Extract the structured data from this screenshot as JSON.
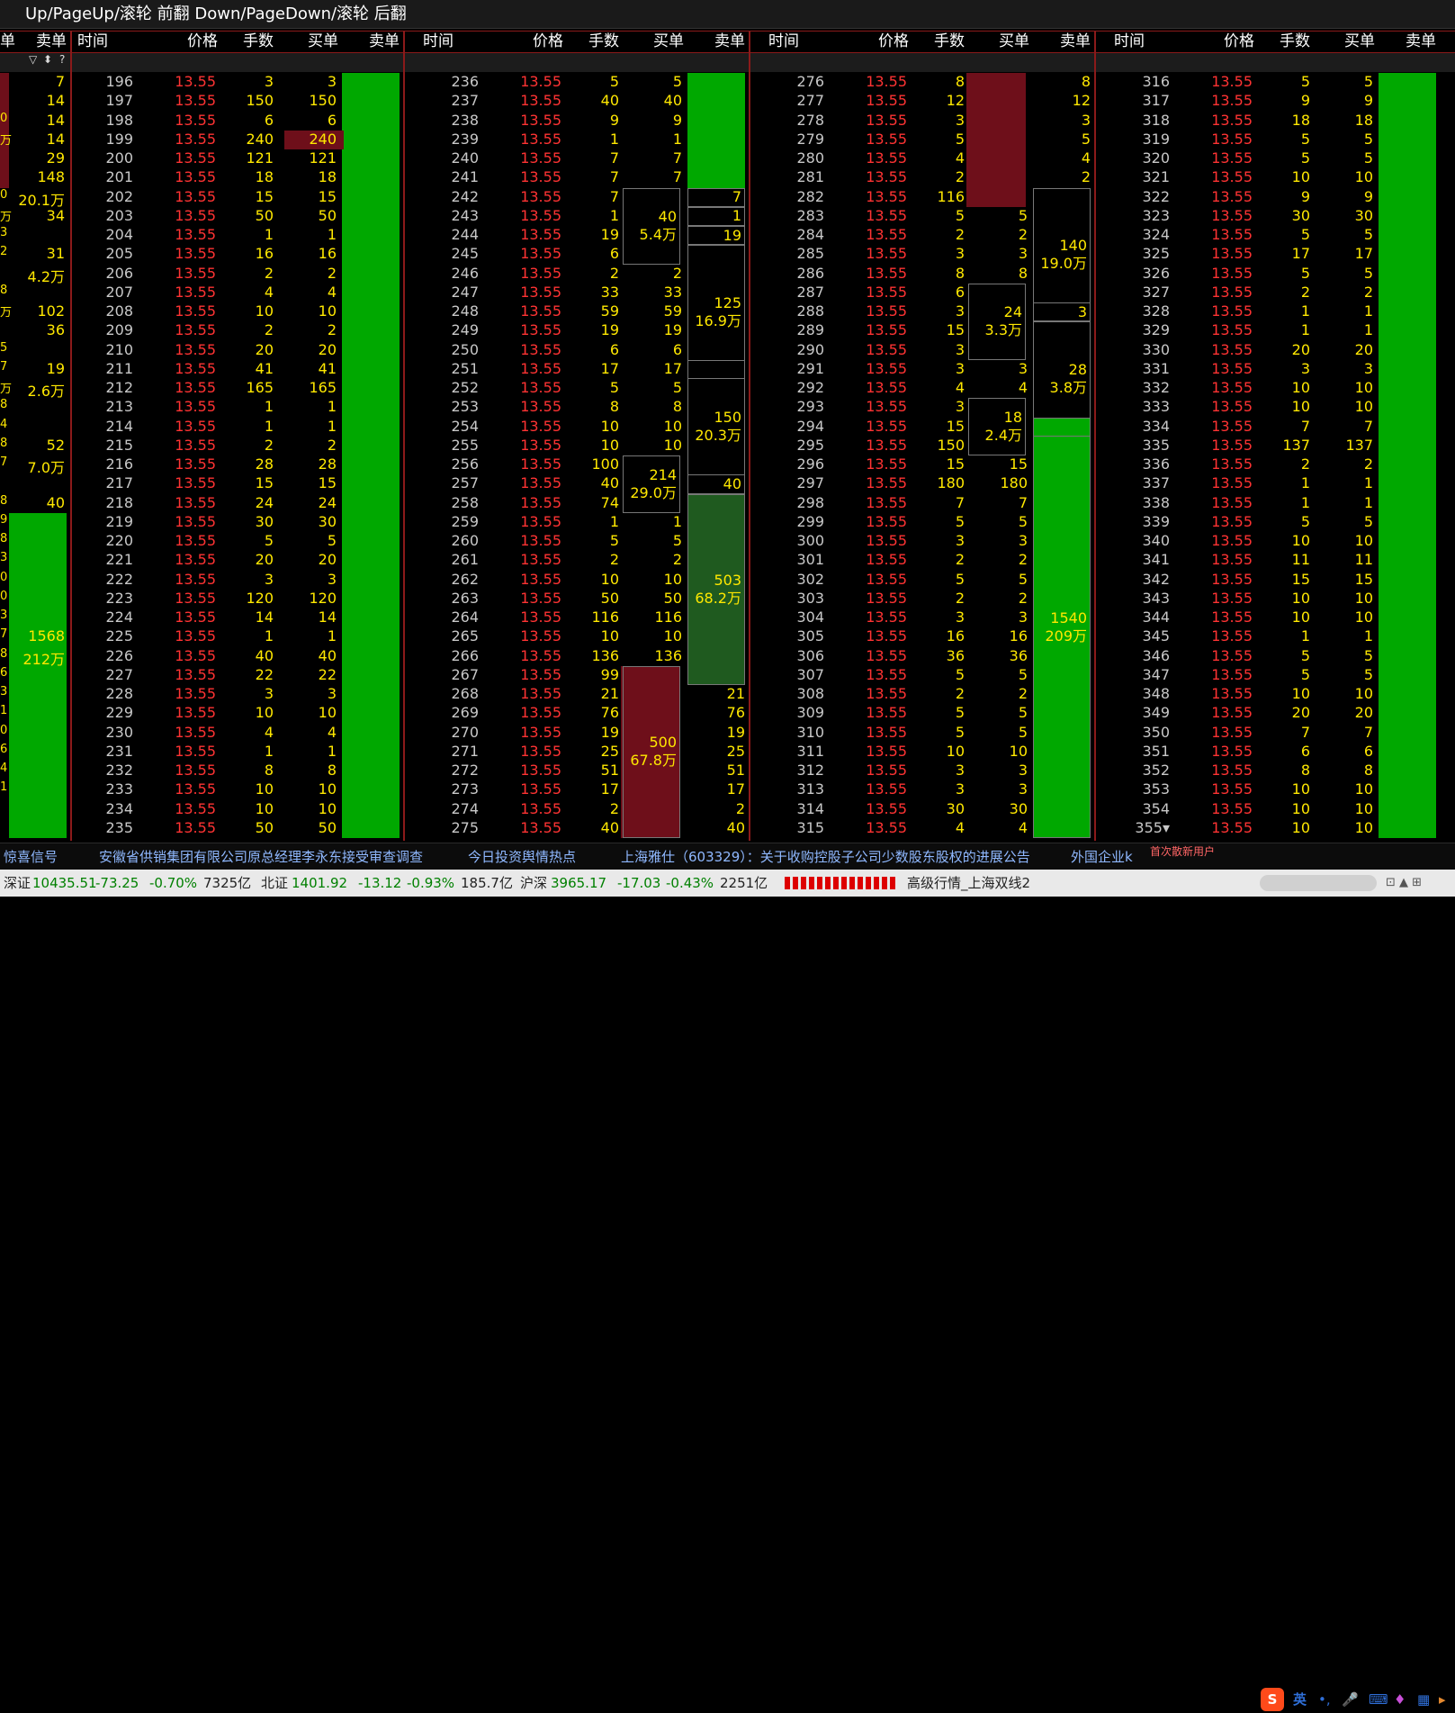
{
  "window": {
    "title": "Up/PageUp/滚轮 前翻 Down/PageDown/滚轮 后翻"
  },
  "columns_header": {
    "time": "时间",
    "price": "价格",
    "qty": "手数",
    "buy": "买单",
    "sell": "卖单",
    "cut_sell": "单",
    "cut_sell2": "卖单"
  },
  "filter_icons": [
    "filter-icon",
    "sort-icon",
    "help-icon"
  ],
  "price": "13.55",
  "left_partial": {
    "col1": [
      "",
      "",
      "0",
      "万",
      "",
      "",
      "0",
      "万",
      "3",
      "2",
      "",
      "8",
      "万",
      "",
      "5",
      "7",
      "万",
      "8",
      "4",
      "8",
      "7",
      "",
      "8",
      "9",
      "8",
      "3",
      "0",
      "0",
      "3",
      "7",
      "8",
      "6",
      "3",
      "1",
      "0",
      "6",
      "4",
      "1"
    ],
    "values": [
      "7",
      "14",
      "14",
      "14",
      "29",
      "148",
      "20.1万",
      "34",
      "",
      "31",
      "4.2万",
      "",
      "102",
      "36",
      "",
      "19",
      "2.6万",
      "",
      "",
      "52",
      "7.0万",
      "",
      "40",
      "",
      "",
      "",
      "",
      "",
      "",
      "1568",
      "212万"
    ]
  },
  "blocks": [
    {
      "start": 196,
      "qty": [
        3,
        150,
        6,
        240,
        121,
        18,
        15,
        50,
        1,
        16,
        2,
        4,
        10,
        2,
        20,
        41,
        165,
        1,
        1,
        2,
        28,
        15,
        24,
        30,
        5,
        20,
        3,
        120,
        14,
        1,
        40,
        22,
        3,
        10,
        4,
        1,
        8,
        10,
        10,
        50
      ]
    },
    {
      "start": 236,
      "qty": [
        5,
        40,
        9,
        1,
        7,
        7,
        7,
        1,
        19,
        6,
        2,
        33,
        59,
        19,
        6,
        17,
        5,
        8,
        10,
        10,
        100,
        40,
        74,
        1,
        5,
        2,
        10,
        50,
        116,
        10,
        136,
        99,
        21,
        76,
        19,
        25,
        51,
        17,
        2,
        40
      ]
    },
    {
      "start": 276,
      "qty": [
        8,
        12,
        3,
        5,
        4,
        2,
        116,
        5,
        2,
        3,
        8,
        6,
        3,
        15,
        3,
        3,
        4,
        3,
        15,
        150,
        15,
        180,
        7,
        5,
        3,
        2,
        5,
        2,
        3,
        16,
        36,
        5,
        2,
        5,
        5,
        10,
        3,
        3,
        30,
        4
      ]
    },
    {
      "start": 316,
      "qty": [
        5,
        9,
        18,
        5,
        5,
        10,
        9,
        30,
        5,
        17,
        5,
        2,
        1,
        1,
        20,
        3,
        10,
        10,
        7,
        137,
        2,
        1,
        1,
        5,
        10,
        11,
        15,
        10,
        10,
        1,
        5,
        5,
        10,
        20,
        7,
        6,
        8,
        10,
        10,
        10
      ]
    }
  ],
  "block_labels": {
    "b1_buy": [
      {
        "row": 3,
        "text": "240"
      }
    ],
    "b2_buy": [
      {
        "rows": [
          6,
          9
        ],
        "a": "40",
        "b": "5.4万"
      },
      {
        "rows": [
          20,
          22
        ],
        "a": "214",
        "b": "29.0万"
      },
      {
        "rows": [
          31,
          39
        ],
        "a": "500",
        "b": "67.8万"
      }
    ],
    "b2_sell": [
      {
        "rows": [
          6,
          6
        ],
        "a": "7"
      },
      {
        "rows": [
          7,
          7
        ],
        "a": "1"
      },
      {
        "rows": [
          8,
          8
        ],
        "a": "19"
      },
      {
        "rows": [
          9,
          15
        ],
        "a": "125",
        "b": "16.9万"
      },
      {
        "rows": [
          15,
          21
        ],
        "a": "150",
        "b": "20.3万"
      },
      {
        "rows": [
          21,
          21
        ],
        "a": "40"
      },
      {
        "rows": [
          22,
          31
        ],
        "a": "503",
        "b": "68.2万"
      }
    ],
    "b3_buy": [
      {
        "rows": [
          11,
          14
        ],
        "a": "24",
        "b": "3.3万"
      },
      {
        "rows": [
          17,
          19
        ],
        "a": "18",
        "b": "2.4万"
      }
    ],
    "b3_sell": [
      {
        "rows": [
          6,
          12
        ],
        "a": "140",
        "b": "19.0万"
      },
      {
        "rows": [
          12,
          12
        ],
        "a": "3"
      },
      {
        "rows": [
          13,
          18
        ],
        "a": "28",
        "b": "3.8万"
      },
      {
        "rows": [
          18,
          39
        ],
        "a": "1540",
        "b": "209万"
      }
    ]
  },
  "last_time_suffix": "355▾",
  "news": [
    "惊喜信号",
    "安徽省供销集团有限公司原总经理李永东接受审查调查",
    "今日投资舆情热点",
    "上海雅仕（603329）：关于收购控股子公司少数股东股权的进展公告",
    "外国企业k"
  ],
  "news_overlay": "首次散新用户",
  "ime": {
    "lang": "英"
  },
  "status": {
    "sz_name": "深证",
    "sz_val": "10435.51",
    "sz_chg": "-73.25",
    "sz_pct": "-0.70%",
    "sz_amt": "7325亿",
    "bz_name": "北证",
    "bz_val": "1401.92",
    "bz_chg": "-13.12",
    "bz_pct": "-0.93%",
    "bz_amt": "185.7亿",
    "hs_name": "沪深",
    "hs_val": "3965.17",
    "hs_chg": "-17.03",
    "hs_pct": "-0.43%",
    "hs_amt": "2251亿",
    "feed": "高级行情_上海双线2"
  },
  "colors": {
    "up": "#ff3333",
    "qty": "#ffe800",
    "green": "#00a800",
    "dark_green": "#1f5a1f",
    "dark_red": "#6e0f1a",
    "border": "#8b1a1a"
  }
}
